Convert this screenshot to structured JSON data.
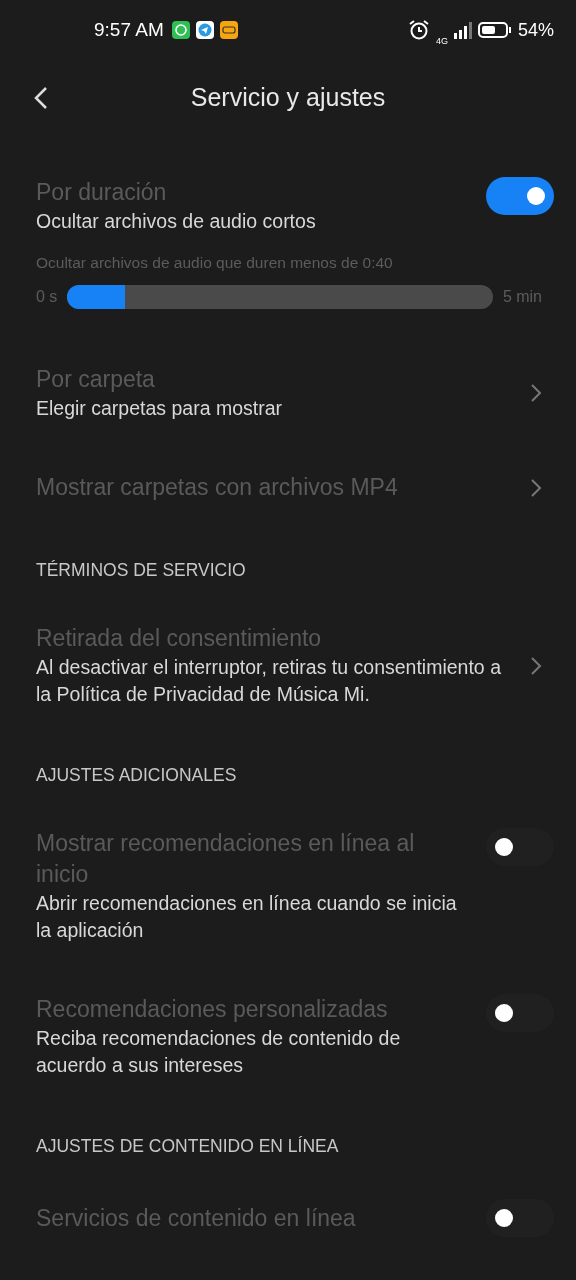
{
  "status_bar": {
    "time": "9:57 AM",
    "network": "4G",
    "battery": "54%"
  },
  "header": {
    "title": "Servicio y ajustes"
  },
  "sections": [
    {
      "items": [
        {
          "kind": "toggle",
          "title": "Por duración",
          "subtitle": "Ocultar archivos de audio cortos",
          "on": true,
          "slider": {
            "caption": "Ocultar archivos de audio que duren menos de 0:40",
            "min_label": "0 s",
            "max_label": "5 min",
            "level": 0.135
          }
        },
        {
          "kind": "link",
          "title": "Por carpeta",
          "subtitle": "Elegir carpetas para mostrar"
        },
        {
          "kind": "link",
          "title": "Mostrar carpetas con archivos MP4"
        }
      ]
    },
    {
      "heading": "TÉRMINOS DE SERVICIO",
      "items": [
        {
          "kind": "link",
          "title": "Retirada del consentimiento",
          "subtitle": "Al desactivar el interruptor, retiras tu consentimiento a la Política de Privacidad de Música Mi."
        }
      ]
    },
    {
      "heading": "AJUSTES ADICIONALES",
      "items": [
        {
          "kind": "toggle",
          "title": "Mostrar recomendaciones en línea al inicio",
          "subtitle": "Abrir recomendaciones en línea cuando se inicia la aplicación",
          "on": false
        },
        {
          "kind": "toggle",
          "title": "Recomendaciones personalizadas",
          "subtitle": "Reciba recomendaciones de contenido de acuerdo a sus intereses",
          "on": false
        }
      ]
    },
    {
      "heading": "AJUSTES DE CONTENIDO EN LÍNEA",
      "items": [
        {
          "kind": "toggle",
          "title": "Servicios de contenido en línea",
          "on": false
        }
      ]
    }
  ]
}
